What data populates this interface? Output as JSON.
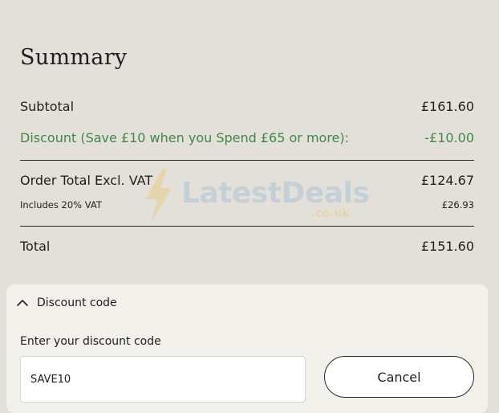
{
  "summary": {
    "title": "Summary",
    "subtotal": {
      "label": "Subtotal",
      "value": "£161.60"
    },
    "discount": {
      "label": "Discount (Save £10 when you Spend £65 or more):",
      "value": "-£10.00"
    },
    "order_total_ex_vat": {
      "label": "Order Total Excl. VAT",
      "value": "£124.67"
    },
    "vat": {
      "label": "Includes 20% VAT",
      "value": "£26.93"
    },
    "total": {
      "label": "Total",
      "value": "£151.60"
    }
  },
  "watermark": {
    "brand": "LatestDeals",
    "suffix": ".co.uk"
  },
  "discount_code": {
    "toggle_label": "Discount code",
    "field_label": "Enter your discount code",
    "input_value": "SAVE10",
    "cancel_label": "Cancel"
  },
  "colors": {
    "page_bg": "#e3e0d9",
    "card_bg": "#f2f0eb",
    "discount_green": "#3c8a45"
  }
}
